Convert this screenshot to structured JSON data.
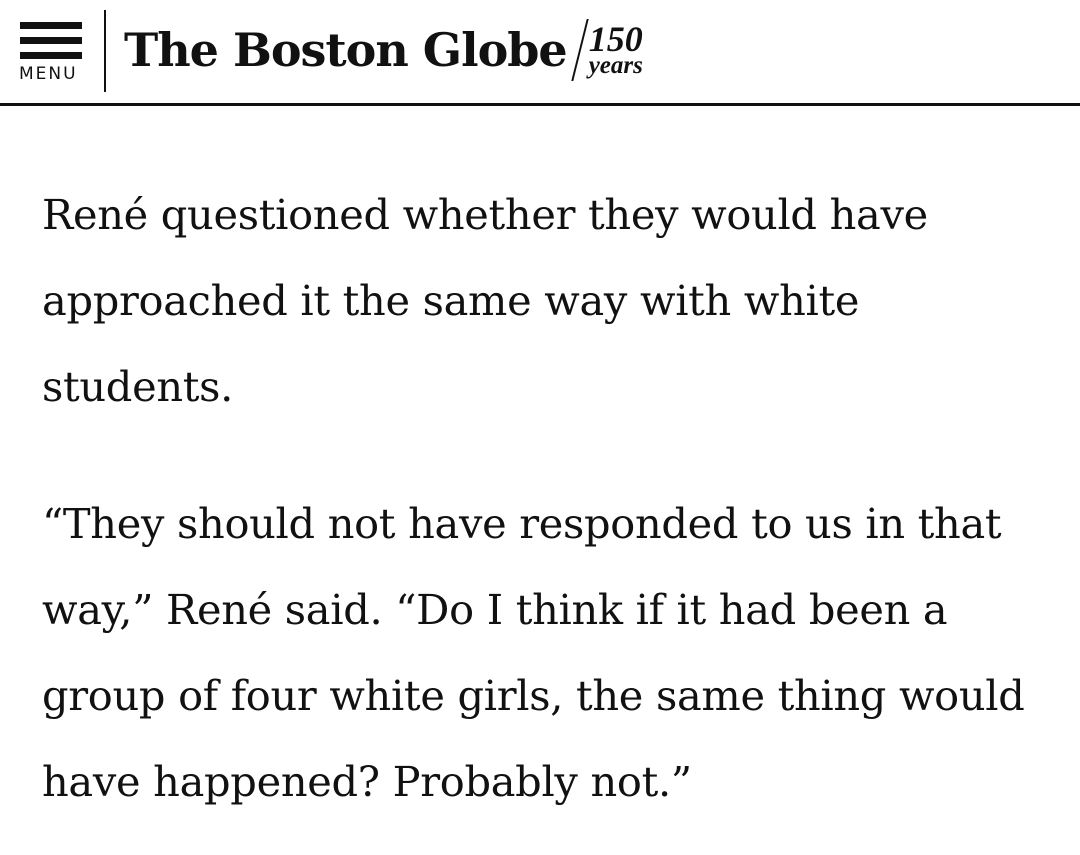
{
  "header": {
    "menu_label": "MENU",
    "logo": {
      "wordmark": "The Boston Globe",
      "anniversary_number": "150",
      "anniversary_word": "years"
    }
  },
  "article": {
    "paragraphs": [
      "René questioned whether they would have approached it the same way with white students.",
      "“They should not have responded to us in that way,” René said. “Do I think if it had been a group of four white girls, the same thing would have happened? Probably not.”"
    ]
  }
}
